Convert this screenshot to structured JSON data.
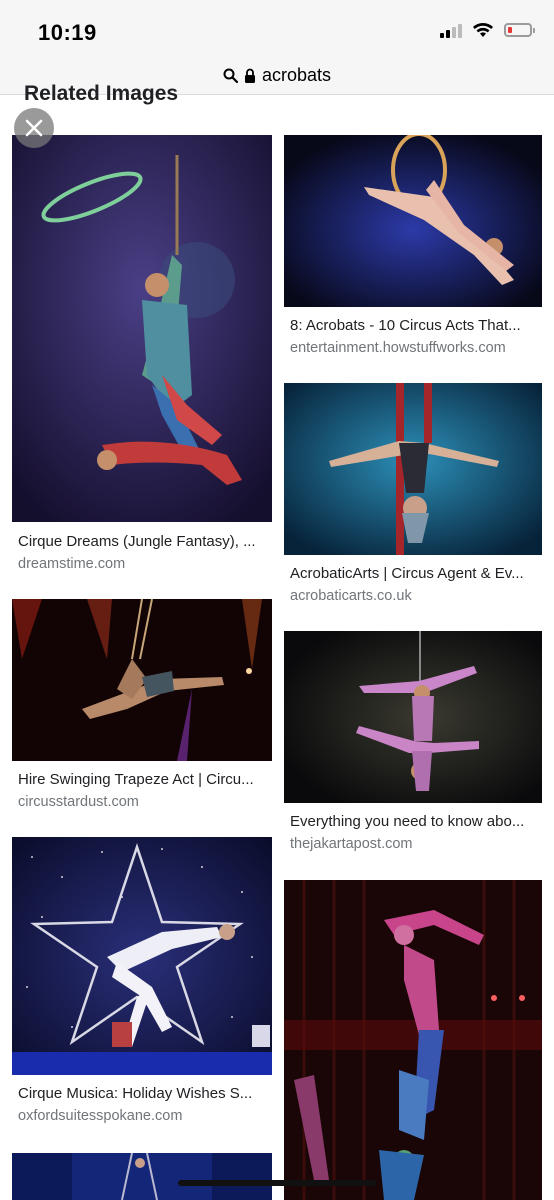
{
  "status": {
    "time": "10:19"
  },
  "url_bar": {
    "text": "acrobats"
  },
  "section": {
    "title": "Related Images"
  },
  "results": [
    {
      "caption": "Cirque Dreams (Jungle Fantasy), ...",
      "domain": "dreamstime.com"
    },
    {
      "caption": "8: Acrobats - 10 Circus Acts That...",
      "domain": "entertainment.howstuffworks.com"
    },
    {
      "caption": "AcrobaticArts | Circus Agent & Ev...",
      "domain": "acrobaticarts.co.uk"
    },
    {
      "caption": "Hire Swinging Trapeze Act | Circu...",
      "domain": "circusstardust.com"
    },
    {
      "caption": "Everything you need to know abo...",
      "domain": "thejakartapost.com"
    },
    {
      "caption": "Cirque Musica: Holiday Wishes S...",
      "domain": "oxfordsuitesspokane.com"
    }
  ],
  "colors": {
    "accent_battery": "#e53935",
    "link_gray": "#70757a"
  }
}
